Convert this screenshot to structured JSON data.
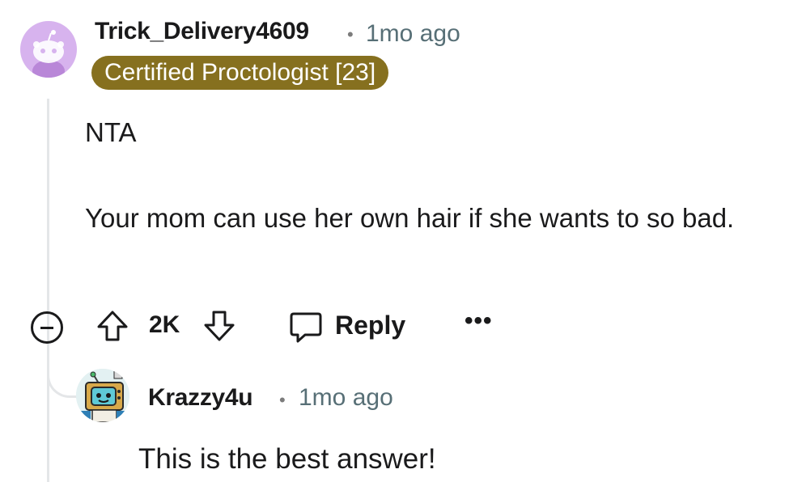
{
  "comment": {
    "username": "Trick_Delivery4609",
    "separator": "•",
    "time": "1mo ago",
    "flair": "Certified Proctologist [23]",
    "body_lines": [
      "NTA",
      "Your mom can use her own hair if she wants to so bad."
    ],
    "avatar": "snoo-avatar-icon",
    "avatar_bg": "#d7b3ee",
    "flair_color": "#86701f"
  },
  "actions": {
    "collapse_icon": "collapse-minus-icon",
    "upvote_icon": "upvote-arrow-icon",
    "score": "2K",
    "downvote_icon": "downvote-arrow-icon",
    "reply_icon": "speech-bubble-icon",
    "reply_label": "Reply",
    "more": "•••"
  },
  "reply": {
    "username": "Krazzy4u",
    "separator": "•",
    "time": "1mo ago",
    "body": "This is the best answer!",
    "avatar": "robot-tv-avatar-icon"
  }
}
